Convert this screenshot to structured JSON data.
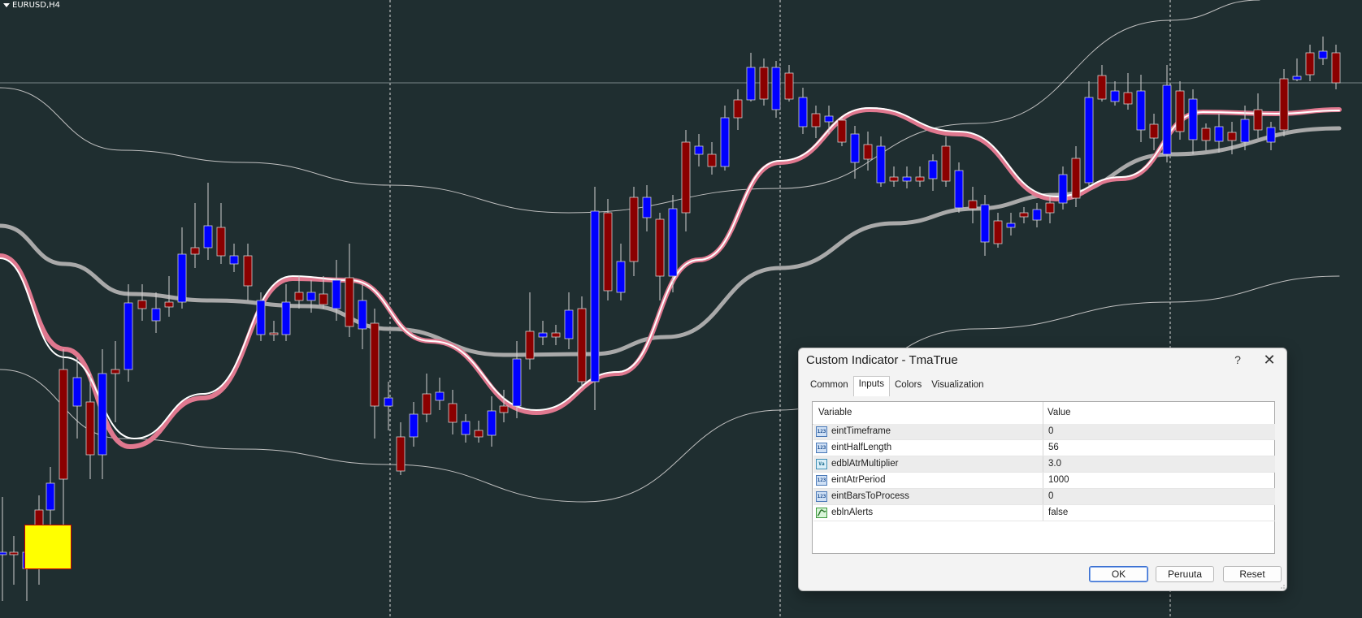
{
  "chart": {
    "symbol": "EURUSD,H4",
    "colors": {
      "background": "#1f2e30",
      "bull_candle": "#0000ff",
      "bear_candle": "#8b0000",
      "tma_main": "#e0788f",
      "tma_fast": "#ffffff",
      "ma_slow": "#a9a9a9",
      "bands": "#c0c0c0",
      "marker": "#ffff00"
    },
    "marker_icon": "yellow-square-marker"
  },
  "dialog": {
    "title": "Custom Indicator - TmaTrue",
    "help_icon": "?",
    "close_icon": "✕",
    "tabs": [
      {
        "label": "Common"
      },
      {
        "label": "Inputs"
      },
      {
        "label": "Colors"
      },
      {
        "label": "Visualization"
      }
    ],
    "active_tab": "Inputs",
    "table": {
      "col_variable": "Variable",
      "col_value": "Value",
      "rows": [
        {
          "icon": "123",
          "name": "eintTimeframe",
          "value": "0"
        },
        {
          "icon": "123",
          "name": "eintHalfLength",
          "value": "56"
        },
        {
          "icon": "Va",
          "name": "edblAtrMultiplier",
          "value": "3.0"
        },
        {
          "icon": "123",
          "name": "eintAtrPeriod",
          "value": "1000"
        },
        {
          "icon": "123",
          "name": "eintBarsToProcess",
          "value": "0"
        },
        {
          "icon": "bool",
          "name": "eblnAlerts",
          "value": "false"
        }
      ]
    },
    "buttons": {
      "ok": "OK",
      "cancel": "Peruuta",
      "reset": "Reset"
    }
  }
}
